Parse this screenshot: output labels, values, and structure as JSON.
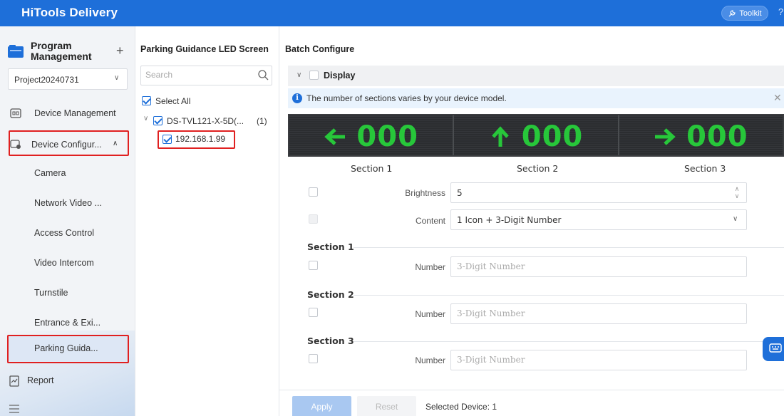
{
  "app": {
    "title": "HiTools Delivery",
    "toolkit_label": "Toolkit",
    "accent": "#1e6fd9"
  },
  "sidebar": {
    "program_title": "Program Management",
    "project": "Project20240731",
    "items": [
      {
        "label": "Device Management",
        "icon": "device-management-icon"
      },
      {
        "label": "Device Configur...",
        "icon": "device-config-icon"
      },
      {
        "label": "Camera"
      },
      {
        "label": "Network Video ..."
      },
      {
        "label": "Access Control"
      },
      {
        "label": "Video Intercom"
      },
      {
        "label": "Turnstile"
      },
      {
        "label": "Entrance & Exi..."
      },
      {
        "label": "Parking Guida..."
      },
      {
        "label": "Report",
        "icon": "report-icon"
      }
    ]
  },
  "middle": {
    "title": "Parking Guidance LED Screen",
    "search_placeholder": "Search",
    "select_all": "Select All",
    "device_name": "DS-TVL121-X-5D(...",
    "device_count": "(1)",
    "device_ip": "192.168.1.99"
  },
  "main": {
    "title": "Batch Configure",
    "display_label": "Display",
    "info_text": "The number of sections varies by your device model.",
    "led": [
      {
        "arrow": "left",
        "number": "000"
      },
      {
        "arrow": "up",
        "number": "000"
      },
      {
        "arrow": "right",
        "number": "000"
      }
    ],
    "led_color": "#27c73a",
    "section_labels": [
      "Section 1",
      "Section 2",
      "Section 3"
    ],
    "brightness_label": "Brightness",
    "brightness_value": "5",
    "content_label": "Content",
    "content_value": "1 Icon + 3-Digit Number",
    "groups": [
      {
        "title": "Section 1",
        "number_label": "Number",
        "placeholder": "3-Digit Number"
      },
      {
        "title": "Section 2",
        "number_label": "Number",
        "placeholder": "3-Digit Number"
      },
      {
        "title": "Section 3",
        "number_label": "Number",
        "placeholder": "3-Digit Number"
      }
    ],
    "apply_label": "Apply",
    "reset_label": "Reset",
    "selected_text": "Selected Device: 1"
  }
}
